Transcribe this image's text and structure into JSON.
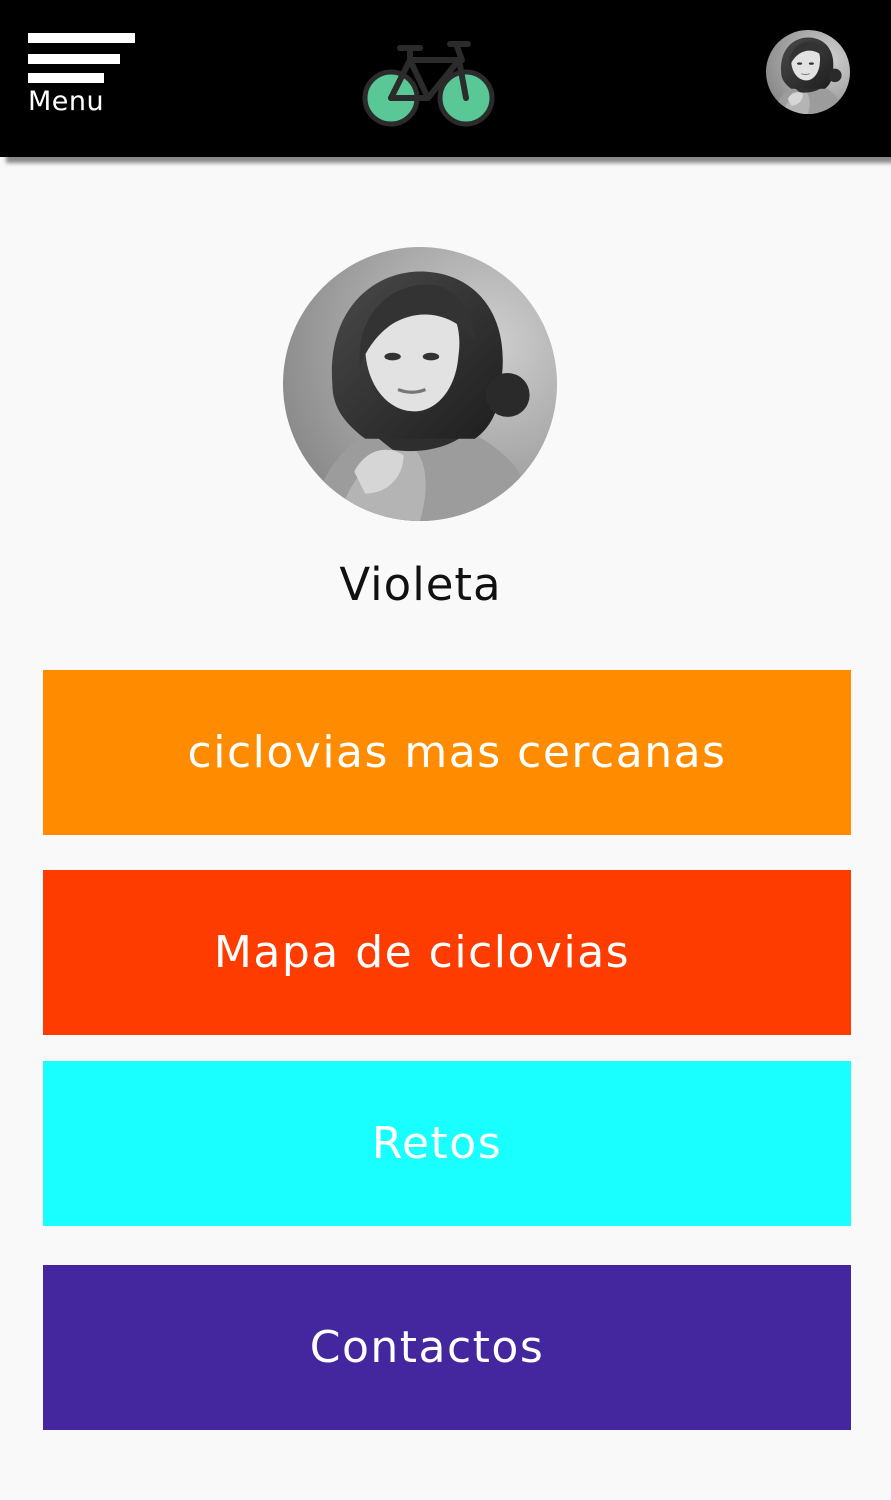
{
  "header": {
    "menu_label": "Menu",
    "logo_icon": "bicycle-icon",
    "logo_color": "#5ac896"
  },
  "profile": {
    "name": "Violeta"
  },
  "nav_buttons": [
    {
      "label": "ciclovias mas cercanas",
      "color": "#ff8c00"
    },
    {
      "label": "Mapa de ciclovias",
      "color": "#ff3c00"
    },
    {
      "label": "Retos",
      "color": "#19ffff"
    },
    {
      "label": "Contactos",
      "color": "#44279f"
    }
  ]
}
